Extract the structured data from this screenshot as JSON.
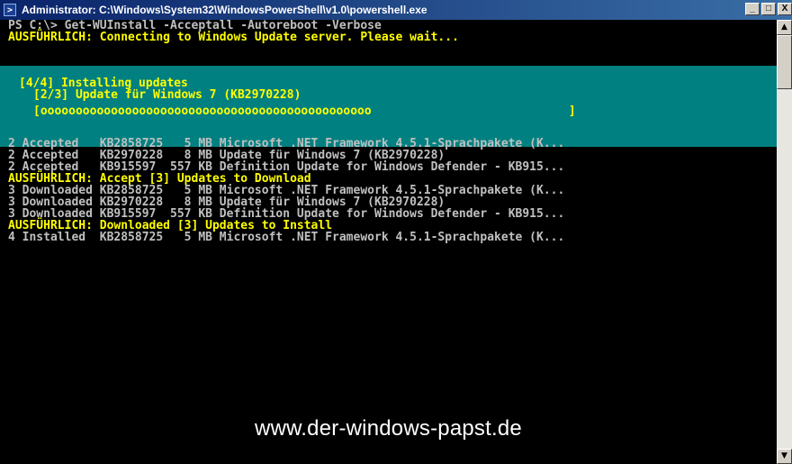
{
  "window": {
    "title": "Administrator: C:\\Windows\\System32\\WindowsPowerShell\\v1.0\\powershell.exe",
    "icon_glyph": ">",
    "controls": {
      "minimize": "_",
      "maximize": "□",
      "close": "X"
    }
  },
  "console": {
    "lines_top": [
      "PS C:\\> Get-WUInstall -Acceptall -Autoreboot -Verbose",
      "AUSFÜHRLICH: Connecting to Windows Update server. Please wait..."
    ],
    "progress": {
      "line1": "[4/4] Installing updates",
      "line2": "[2/3] Update für Windows 7 (KB2970228)",
      "line3": "[ooooooooooooooooooooooooooooooooooooooooooooooo                            ]"
    },
    "lines_body": [
      "2 Accepted   KB2858725   5 MB Microsoft .NET Framework 4.5.1-Sprachpakete (K...",
      "2 Accepted   KB2970228   8 MB Update für Windows 7 (KB2970228)",
      "2 Accepted   KB915597  557 KB Definition Update for Windows Defender - KB915...",
      "AUSFÜHRLICH: Accept [3] Updates to Download",
      "3 Downloaded KB2858725   5 MB Microsoft .NET Framework 4.5.1-Sprachpakete (K...",
      "3 Downloaded KB2970228   8 MB Update für Windows 7 (KB2970228)",
      "3 Downloaded KB915597  557 KB Definition Update for Windows Defender - KB915...",
      "AUSFÜHRLICH: Downloaded [3] Updates to Install",
      "4 Installed  KB2858725   5 MB Microsoft .NET Framework 4.5.1-Sprachpakete (K..."
    ]
  },
  "watermark": "www.der-windows-papst.de",
  "scrollbar": {
    "up": "▲",
    "down": "▼"
  },
  "colors": {
    "background": "#000000",
    "text": "#c0c0c0",
    "verbose": "#ffff00",
    "progress_bg": "#008080"
  }
}
